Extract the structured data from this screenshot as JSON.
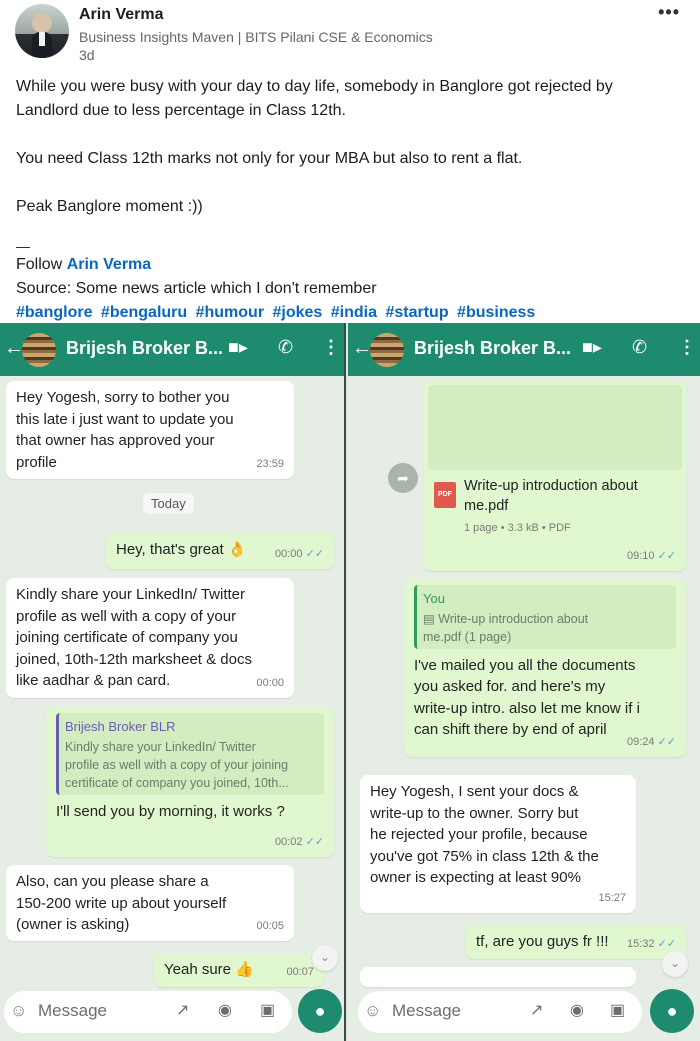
{
  "post": {
    "author_name": "Arin Verma",
    "author_tagline": "Business Insights Maven | BITS Pilani CSE & Economics",
    "age": "3d",
    "more_icon": "•••",
    "text_line1": "While you were busy with your day to day life, somebody in Banglore got rejected by",
    "text_line2": "Landlord due to less percentage in Class 12th.",
    "text_para2": "You need Class 12th marks not only for your MBA but also to rent a flat.",
    "text_para3": "Peak Banglore moment :))",
    "rule": "—",
    "follow_prefix": "Follow ",
    "follow_link": "Arin Verma",
    "source": "Source: Some news article which I don't remember",
    "hashtags": [
      "#banglore",
      "#bengaluru",
      "#humour",
      "#jokes",
      "#india",
      "#startup",
      "#business"
    ]
  },
  "chat_left": {
    "contact": "Brijesh Broker B...",
    "msg1": {
      "lines": [
        "Hey Yogesh, sorry to bother you",
        "this late i just want to update you",
        "that owner has approved your",
        "profile"
      ],
      "time": "23:59"
    },
    "date_chip": "Today",
    "msg2": {
      "text": "Hey, that's great 👌",
      "time": "00:00"
    },
    "msg3": {
      "lines": [
        "Kindly share your LinkedIn/ Twitter",
        "profile as well with a copy of your",
        "joining certificate of company you",
        "joined, 10th-12th marksheet & docs",
        "like aadhar & pan card."
      ],
      "time": "00:00"
    },
    "msg4": {
      "quote_author": "Brijesh Broker BLR",
      "quote_lines": [
        "Kindly share your LinkedIn/ Twitter",
        "profile as well with a copy of your joining",
        "certificate of company you joined, 10th..."
      ],
      "text": "I'll send you by morning, it works ?",
      "time": "00:02"
    },
    "msg5": {
      "lines": [
        "Also, can you please share a",
        "150-200 write up about yourself",
        "(owner is asking)"
      ],
      "time": "00:05"
    },
    "msg6": {
      "text": "Yeah sure 👍",
      "time": "00:07"
    },
    "input_placeholder": "Message"
  },
  "chat_right": {
    "contact": "Brijesh Broker B...",
    "doc_msg": {
      "title_lines": [
        "Write-up introduction about",
        "me.pdf"
      ],
      "meta": "1 page • 3.3 kB • PDF",
      "pdf_label": "PDF",
      "time": "09:10"
    },
    "msg2": {
      "quote_author": "You",
      "quote_lines": [
        "▤ Write-up introduction about",
        "me.pdf (1 page)"
      ],
      "lines": [
        "I've mailed you all the documents",
        "you asked for. and here's my",
        "write-up intro. also let me know if i",
        "can shift there by end of april"
      ],
      "time": "09:24"
    },
    "msg3": {
      "lines": [
        "Hey Yogesh, I sent your docs &",
        "write-up to the owner. Sorry but",
        "he rejected your profile, because",
        "you've got 75% in class 12th & the",
        "owner is expecting at least 90%"
      ],
      "time": "15:27"
    },
    "msg4": {
      "text": "tf, are you guys fr !!!",
      "time": "15:32"
    },
    "input_placeholder": "Message"
  },
  "colors": {
    "linkedin_link": "#0a66c2",
    "whatsapp_header": "#1e8a6e",
    "outgoing_bubble": "#e1f7cf",
    "chat_background": "#e6ede4"
  },
  "icons": [
    "back-arrow-icon",
    "video-call-icon",
    "phone-icon",
    "menu-dots-icon",
    "emoji-icon",
    "attach-icon",
    "payment-icon",
    "camera-icon",
    "mic-icon",
    "forward-icon",
    "scroll-down-icon",
    "pdf-icon",
    "read-receipt-icon"
  ]
}
